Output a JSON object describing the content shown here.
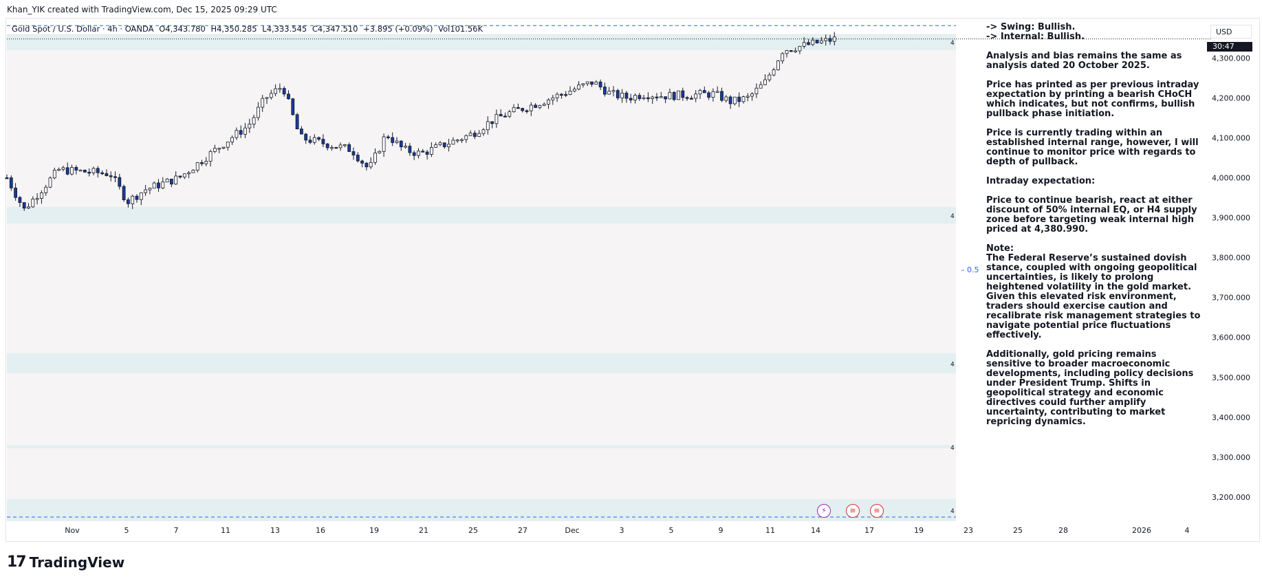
{
  "header": {
    "attribution": "Khan_YIK created with TradingView.com, Dec 15, 2025 09:29 UTC"
  },
  "legend": {
    "symbol": "Gold Spot / U.S. Dollar · 4h · OANDA",
    "open": "O4,343.780",
    "high": "H4,350.285",
    "low": "L4,333.545",
    "close": "C4,347.510",
    "change": "+3.895 (+0.09%)",
    "volume": "Vol101.56K"
  },
  "currency_button": "USD",
  "countdown": "30:47",
  "eq_label": "0.5",
  "zone_marker": "4",
  "events": {
    "flash_icon": "lightning-icon",
    "flag_icon": "us-flag-icon"
  },
  "analysis": {
    "swing": "-> Swing:  Bullish.",
    "internal": "-> Internal:  Bullish.",
    "p1": "Analysis and bias remains the same as analysis dated 20 October 2025.",
    "p2": "Price has printed as per previous intraday expectation by printing a bearish CHoCH which indicates, but not confirms, bullish pullback phase initiation.",
    "p3": "Price is currently trading within an established internal range, however, I will continue to monitor price with regards to depth of pullback.",
    "p4": "Intraday expectation:",
    "p5": "Price to continue bearish, react at either discount of 50% internal EQ, or H4 supply zone before targeting weak internal high priced at 4,380.990.",
    "note_title": "Note:",
    "p6": "The Federal Reserve’s sustained dovish stance, coupled with ongoing geopolitical uncertainties, is likely to prolong heightened volatility in the gold market. Given this elevated risk environment, traders should exercise caution and recalibrate risk management strategies to navigate potential price fluctuations effectively.",
    "p7": "Additionally, gold pricing remains sensitive to broader macroeconomic developments, including policy decisions under President Trump. Shifts in geopolitical strategy and economic directives could further amplify uncertainty, contributing to market repricing dynamics."
  },
  "footer": {
    "brand": "TradingView"
  },
  "colors": {
    "bullish_body": "#ffffff",
    "bearish_body": "#1a3a9c",
    "wick": "#131722",
    "zone_fill": "#e3eff0",
    "background_range": "#f6f4f5",
    "accent": "#2962ff"
  },
  "chart_data": {
    "type": "candlestick",
    "symbol": "Gold Spot / U.S. Dollar",
    "timeframe": "4h",
    "ylim": [
      3150,
      4390
    ],
    "y_ticks": [
      "4,300.000",
      "4,200.000",
      "4,100.000",
      "4,000.000",
      "3,900.000",
      "3,800.000",
      "3,700.000",
      "3,600.000",
      "3,500.000",
      "3,400.000",
      "3,300.000",
      "3,200.000"
    ],
    "x_ticks": [
      "Nov",
      "5",
      "7",
      "11",
      "13",
      "16",
      "19",
      "21",
      "25",
      "27",
      "Dec",
      "3",
      "5",
      "9",
      "11",
      "14",
      "17",
      "19",
      "23",
      "25",
      "28",
      "2026",
      "4"
    ],
    "x_range": [
      "2025-10-28",
      "2026-01-05"
    ],
    "zones": [
      {
        "top": 4360,
        "bottom": 4320
      },
      {
        "top": 3927,
        "bottom": 3885
      },
      {
        "top": 3560,
        "bottom": 3510
      },
      {
        "top": 3330,
        "bottom": 3322
      },
      {
        "top": 3195,
        "bottom": 3140
      }
    ],
    "dashed_levels": [
      4381,
      3150
    ],
    "last_price_line": 4347.5,
    "ohlc_anchor_points": [
      {
        "date": "2025-10-28",
        "price": 4000
      },
      {
        "date": "2025-10-29",
        "price": 3920
      },
      {
        "date": "2025-10-31",
        "price": 4020
      },
      {
        "date": "2025-11-03",
        "price": 4010
      },
      {
        "date": "2025-11-04",
        "price": 3940
      },
      {
        "date": "2025-11-05",
        "price": 3970
      },
      {
        "date": "2025-11-07",
        "price": 4000
      },
      {
        "date": "2025-11-10",
        "price": 4100
      },
      {
        "date": "2025-11-11",
        "price": 4130
      },
      {
        "date": "2025-11-12",
        "price": 4200
      },
      {
        "date": "2025-11-13",
        "price": 4230
      },
      {
        "date": "2025-11-14",
        "price": 4100
      },
      {
        "date": "2025-11-17",
        "price": 4070
      },
      {
        "date": "2025-11-18",
        "price": 4020
      },
      {
        "date": "2025-11-19",
        "price": 4110
      },
      {
        "date": "2025-11-20",
        "price": 4070
      },
      {
        "date": "2025-11-21",
        "price": 4060
      },
      {
        "date": "2025-11-24",
        "price": 4110
      },
      {
        "date": "2025-11-25",
        "price": 4140
      },
      {
        "date": "2025-11-26",
        "price": 4160
      },
      {
        "date": "2025-11-28",
        "price": 4190
      },
      {
        "date": "2025-12-01",
        "price": 4240
      },
      {
        "date": "2025-12-02",
        "price": 4210
      },
      {
        "date": "2025-12-03",
        "price": 4200
      },
      {
        "date": "2025-12-04",
        "price": 4210
      },
      {
        "date": "2025-12-05",
        "price": 4205
      },
      {
        "date": "2025-12-08",
        "price": 4210
      },
      {
        "date": "2025-12-09",
        "price": 4190
      },
      {
        "date": "2025-12-10",
        "price": 4200
      },
      {
        "date": "2025-12-11",
        "price": 4240
      },
      {
        "date": "2025-12-12",
        "price": 4320
      },
      {
        "date": "2025-12-15",
        "price": 4347
      }
    ]
  }
}
